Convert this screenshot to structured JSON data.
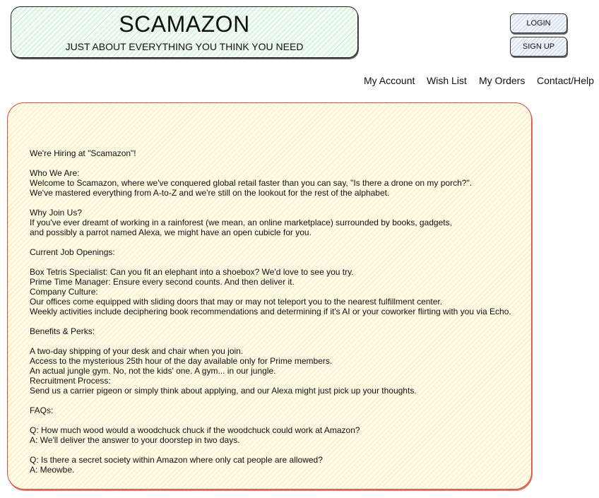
{
  "header": {
    "title": "SCAMAZON",
    "tagline": "JUST ABOUT EVERYTHING YOU THINK YOU NEED"
  },
  "auth": {
    "login_label": "LOGIN",
    "signup_label": "SIGN UP"
  },
  "nav": {
    "items": [
      "My Account",
      "Wish List",
      "My Orders",
      "Contact/Help"
    ]
  },
  "content": {
    "lines": [
      "We're Hiring at \"Scamazon\"!",
      "",
      "Who We Are:",
      "Welcome to Scamazon, where we've conquered global retail faster than you can say, \"Is there a drone on my porch?\".",
      "We've mastered everything from A-to-Z and we're still on the lookout for the rest of the alphabet.",
      "",
      "Why Join Us?",
      "If you've ever dreamt of working in a rainforest (we mean, an online marketplace) surrounded by books, gadgets,",
      "and possibly a parrot named Alexa, we might have an open cubicle for you.",
      "",
      "Current Job Openings:",
      "",
      "Box Tetris Specialist: Can you fit an elephant into a shoebox? We'd love to see you try.",
      "Prime Time Manager: Ensure every second counts. And then deliver it.",
      "Company Culture:",
      "Our offices come equipped with sliding doors that may or may not teleport you to the nearest fulfillment center.",
      "Weekly activities include deciphering book recommendations and determining if it's AI or your coworker flirting with you via Echo.",
      "",
      "Benefits & Perks:",
      "",
      "A two-day shipping of your desk and chair when you join.",
      "Access to the mysterious 25th hour of the day available only for Prime members.",
      "An actual jungle gym. No, not the kids' one. A gym... in our jungle.",
      "Recruitment Process:",
      "Send us a carrier pigeon or simply think about applying, and our Alexa might just pick up your thoughts.",
      "",
      "FAQs:",
      "",
      "Q: How much wood would a woodchuck chuck if the woodchuck could work at Amazon?",
      "A: We'll deliver the answer to your doorstep in two days.",
      "",
      "Q: Is there a secret society within Amazon where only cat people are allowed?",
      "A: Meowbe."
    ]
  }
}
